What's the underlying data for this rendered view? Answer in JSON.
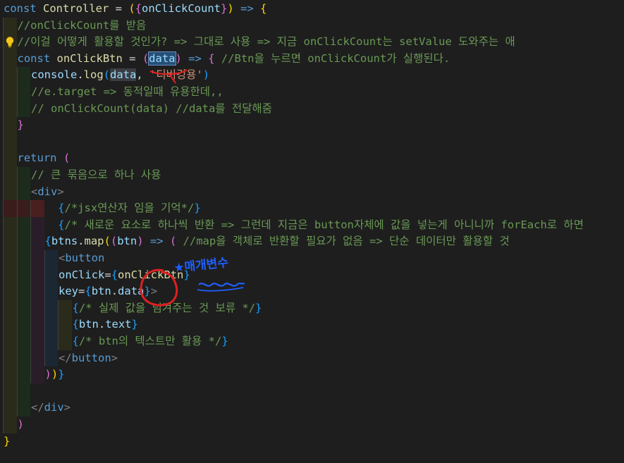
{
  "editor": {
    "lines": [
      {
        "indent": 0,
        "guides": [],
        "tokens": [
          {
            "c": "kw",
            "t": "const "
          },
          {
            "c": "fn",
            "t": "Controller"
          },
          {
            "c": "",
            "t": " = "
          },
          {
            "c": "br1",
            "t": "("
          },
          {
            "c": "br2",
            "t": "{"
          },
          {
            "c": "var",
            "t": "onClickCount"
          },
          {
            "c": "br2",
            "t": "}"
          },
          {
            "c": "br1",
            "t": ")"
          },
          {
            "c": "kw",
            "t": " => "
          },
          {
            "c": "br1",
            "t": "{"
          }
        ]
      },
      {
        "indent": 1,
        "guides": [
          1
        ],
        "tokens": [
          {
            "c": "cm",
            "t": "//onClickCount를 받음"
          }
        ]
      },
      {
        "indent": 1,
        "guides": [
          1
        ],
        "bulb": true,
        "tokens": [
          {
            "c": "cm",
            "t": "//이걸 어떻게 활용할 것인가? => 그대로 사용 => 지금 onClickCount는 setValue 도와주는 애"
          }
        ]
      },
      {
        "indent": 1,
        "guides": [
          1
        ],
        "tokens": [
          {
            "c": "kw",
            "t": "const "
          },
          {
            "c": "fn",
            "t": "onClickBtn"
          },
          {
            "c": "",
            "t": " = "
          },
          {
            "c": "br2",
            "t": "("
          },
          {
            "c": "var sel",
            "t": "data"
          },
          {
            "c": "br2",
            "t": ")"
          },
          {
            "c": "kw",
            "t": " => "
          },
          {
            "c": "br2",
            "t": "{"
          },
          {
            "c": "cm",
            "t": " //Btn을 누르면 onClickCount가 실행된다."
          }
        ]
      },
      {
        "indent": 2,
        "guides": [
          1,
          2
        ],
        "tokens": [
          {
            "c": "var",
            "t": "console"
          },
          {
            "c": "",
            "t": "."
          },
          {
            "c": "fn",
            "t": "log"
          },
          {
            "c": "br3",
            "t": "("
          },
          {
            "c": "var hl",
            "t": "data"
          },
          {
            "c": "",
            "t": ", "
          },
          {
            "c": "str",
            "t": "'디버깅용'"
          },
          {
            "c": "br3",
            "t": ")"
          }
        ]
      },
      {
        "indent": 2,
        "guides": [
          1,
          2
        ],
        "tokens": [
          {
            "c": "cm",
            "t": "//e.target => 동적일때 유용한데,,"
          }
        ]
      },
      {
        "indent": 2,
        "guides": [
          1,
          2
        ],
        "tokens": [
          {
            "c": "cm",
            "t": "// onClickCount(data) //data를 전달해줌"
          }
        ]
      },
      {
        "indent": 1,
        "guides": [
          1
        ],
        "tokens": [
          {
            "c": "br2",
            "t": "}"
          }
        ]
      },
      {
        "indent": 0,
        "guides": [
          1
        ],
        "tokens": []
      },
      {
        "indent": 1,
        "guides": [
          1
        ],
        "tokens": [
          {
            "c": "kw",
            "t": "return "
          },
          {
            "c": "br2",
            "t": "("
          }
        ]
      },
      {
        "indent": 2,
        "guides": [
          1,
          2
        ],
        "tokens": [
          {
            "c": "cm",
            "t": "// 큰 묶음으로 하나 사용"
          }
        ]
      },
      {
        "indent": 2,
        "guides": [
          1,
          2
        ],
        "tokens": [
          {
            "c": "tag",
            "t": "<"
          },
          {
            "c": "tagn",
            "t": "div"
          },
          {
            "c": "tag",
            "t": ">"
          }
        ]
      },
      {
        "indent": 3,
        "guides": [
          1,
          2,
          3
        ],
        "err": true,
        "tokens": [
          {
            "c": "br3",
            "t": "  {"
          },
          {
            "c": "cm",
            "t": "/*jsx연산자 임을 기억*/"
          },
          {
            "c": "br3",
            "t": "}"
          }
        ]
      },
      {
        "indent": 3,
        "guides": [
          1,
          2,
          3
        ],
        "tokens": [
          {
            "c": "br3",
            "t": "  {"
          },
          {
            "c": "cm",
            "t": "/* 새로운 요소로 하나씩 반환 => 그런데 지금은 button자체에 값을 넣는게 아니니까 forEach로 하면"
          }
        ]
      },
      {
        "indent": 3,
        "guides": [
          1,
          2,
          3
        ],
        "tokens": [
          {
            "c": "br3",
            "t": "{"
          },
          {
            "c": "var",
            "t": "btns"
          },
          {
            "c": "",
            "t": "."
          },
          {
            "c": "fn",
            "t": "map"
          },
          {
            "c": "br1",
            "t": "("
          },
          {
            "c": "br2",
            "t": "("
          },
          {
            "c": "var",
            "t": "btn"
          },
          {
            "c": "br2",
            "t": ")"
          },
          {
            "c": "kw",
            "t": " => "
          },
          {
            "c": "br2",
            "t": "("
          },
          {
            "c": "cm",
            "t": " //map을 객체로 반환할 필요가 없음 => 단순 데이터만 활용할 것"
          }
        ]
      },
      {
        "indent": 4,
        "guides": [
          1,
          2,
          3,
          4
        ],
        "tokens": [
          {
            "c": "tag",
            "t": "<"
          },
          {
            "c": "tagn",
            "t": "button"
          }
        ]
      },
      {
        "indent": 4,
        "guides": [
          1,
          2,
          3,
          4
        ],
        "tokens": [
          {
            "c": "var",
            "t": "onClick"
          },
          {
            "c": "",
            "t": "="
          },
          {
            "c": "br3",
            "t": "{"
          },
          {
            "c": "fn",
            "t": "onClickBtn"
          },
          {
            "c": "br3",
            "t": "}"
          }
        ]
      },
      {
        "indent": 4,
        "guides": [
          1,
          2,
          3,
          4
        ],
        "tokens": [
          {
            "c": "var",
            "t": "key"
          },
          {
            "c": "",
            "t": "="
          },
          {
            "c": "br3",
            "t": "{"
          },
          {
            "c": "var",
            "t": "btn"
          },
          {
            "c": "",
            "t": "."
          },
          {
            "c": "var",
            "t": "data"
          },
          {
            "c": "br3",
            "t": "}"
          },
          {
            "c": "tag",
            "t": ">"
          }
        ]
      },
      {
        "indent": 5,
        "guides": [
          1,
          2,
          3,
          4,
          5
        ],
        "tokens": [
          {
            "c": "br3",
            "t": "{"
          },
          {
            "c": "cm",
            "t": "/* 실제 값을 넘겨주는 것 보류 */"
          },
          {
            "c": "br3",
            "t": "}"
          }
        ]
      },
      {
        "indent": 5,
        "guides": [
          1,
          2,
          3,
          4,
          5
        ],
        "tokens": [
          {
            "c": "br3",
            "t": "{"
          },
          {
            "c": "var",
            "t": "btn"
          },
          {
            "c": "",
            "t": "."
          },
          {
            "c": "var",
            "t": "text"
          },
          {
            "c": "br3",
            "t": "}"
          }
        ]
      },
      {
        "indent": 5,
        "guides": [
          1,
          2,
          3,
          4,
          5
        ],
        "tokens": [
          {
            "c": "br3",
            "t": "{"
          },
          {
            "c": "cm",
            "t": "/* btn의 텍스트만 활용 */"
          },
          {
            "c": "br3",
            "t": "}"
          }
        ]
      },
      {
        "indent": 4,
        "guides": [
          1,
          2,
          3,
          4
        ],
        "tokens": [
          {
            "c": "tag",
            "t": "</"
          },
          {
            "c": "tagn",
            "t": "button"
          },
          {
            "c": "tag",
            "t": ">"
          }
        ]
      },
      {
        "indent": 3,
        "guides": [
          1,
          2,
          3
        ],
        "tokens": [
          {
            "c": "br2",
            "t": ")"
          },
          {
            "c": "br1",
            "t": ")"
          },
          {
            "c": "br3",
            "t": "}"
          }
        ]
      },
      {
        "indent": 0,
        "guides": [
          1,
          2
        ],
        "tokens": []
      },
      {
        "indent": 2,
        "guides": [
          1,
          2
        ],
        "tokens": [
          {
            "c": "tag",
            "t": "</"
          },
          {
            "c": "tagn",
            "t": "div"
          },
          {
            "c": "tag",
            "t": ">"
          }
        ]
      },
      {
        "indent": 1,
        "guides": [
          1
        ],
        "tokens": [
          {
            "c": "br2",
            "t": ")"
          }
        ]
      },
      {
        "indent": 0,
        "guides": [],
        "tokens": [
          {
            "c": "br1",
            "t": "}"
          }
        ]
      }
    ]
  },
  "annotation": {
    "note": "★매개변수",
    "color": "#1f5fff",
    "underline_color": "#e02020"
  },
  "colors": {
    "background": "#1e1e1e",
    "keyword": "#569cd6",
    "function": "#dcdcaa",
    "variable": "#9cdcfe",
    "comment": "#6a9955",
    "string": "#ce9178"
  },
  "icons": {
    "gutter": "lightbulb-icon"
  }
}
